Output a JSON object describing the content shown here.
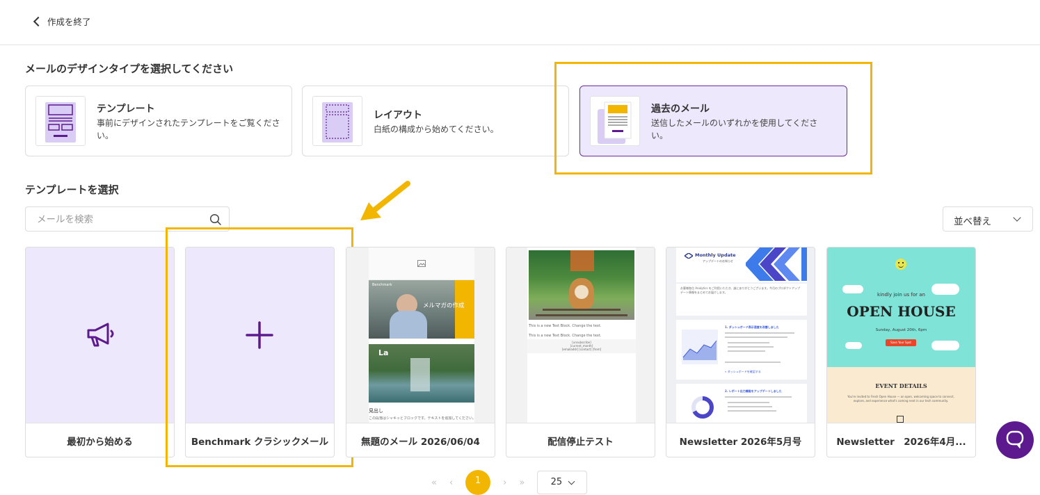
{
  "header": {
    "back_label": "作成を終了"
  },
  "design_type": {
    "heading": "メールのデザインタイプを選択してください",
    "options": [
      {
        "title": "テンプレート",
        "desc": "事前にデザインされたテンプレートをご覧ください。",
        "selected": false
      },
      {
        "title": "レイアウト",
        "desc": "白紙の構成から始めてください。",
        "selected": false
      },
      {
        "title": "過去のメール",
        "desc": "送信したメールのいずれかを使用してください。",
        "selected": true
      }
    ]
  },
  "templates": {
    "heading": "テンプレートを選択",
    "search": {
      "placeholder": "メールを検索",
      "value": ""
    },
    "sort_label": "並べ替え",
    "cards": [
      {
        "label": "最初から始める",
        "icon": "megaphone-icon"
      },
      {
        "label": "Benchmark クラシックメール",
        "icon": "plus-icon"
      },
      {
        "label": "無題のメール 2026/06/04"
      },
      {
        "label": "配信停止テスト"
      },
      {
        "label": "Newsletter 2026年5月号"
      },
      {
        "label": "Newsletter　2026年4月..."
      }
    ]
  },
  "thumbnails": {
    "t3": {
      "brand": "Benchmark",
      "overlay": "メルマガの作成",
      "sub": "La",
      "heading": "見出し",
      "body": "この段落はシャキッとブロックです。テキストを追加してください。"
    },
    "t4": {
      "line1": "This is a new Text Block. Change the text.",
      "line2": "This is a new Text Block. Change the text.",
      "footer1": "[unsubscribe]",
      "footer2": "[current_month]",
      "footer3": "[emailaddr]   [contact]   [from]"
    },
    "t5": {
      "title": "Monthly Update",
      "subtitle": "アップデートのお知らせ",
      "intro": "お客様各位 Analytics をご利用いただき、誠にありがとうございます。今月のプロダクトアップデート情報をまとめてお届けします。",
      "sec1": "1. ダッシュボード表示速度を改善しました",
      "sec1_link": "» ダッシュボードを確認する",
      "sec2": "2. レポート出力機能をアップデートしました"
    },
    "t6": {
      "invite": "kindly join us for an",
      "title": "OPEN HOUSE",
      "date": "Sunday, August 20th, 6pm",
      "button": "Save Your Spot",
      "details": "EVENT DETAILS",
      "details_text": "You're invited to Fresh Open House — an open, welcoming space to connect, explore, and experience what's coming next in our tech community."
    }
  },
  "pagination": {
    "first": "«",
    "prev": "‹",
    "current": "1",
    "next": "›",
    "last": "»",
    "per_page": "25"
  },
  "colors": {
    "accent_purple": "#5d1a8f",
    "card_lavender": "#ede8fb",
    "highlight_yellow": "#f2b600"
  }
}
